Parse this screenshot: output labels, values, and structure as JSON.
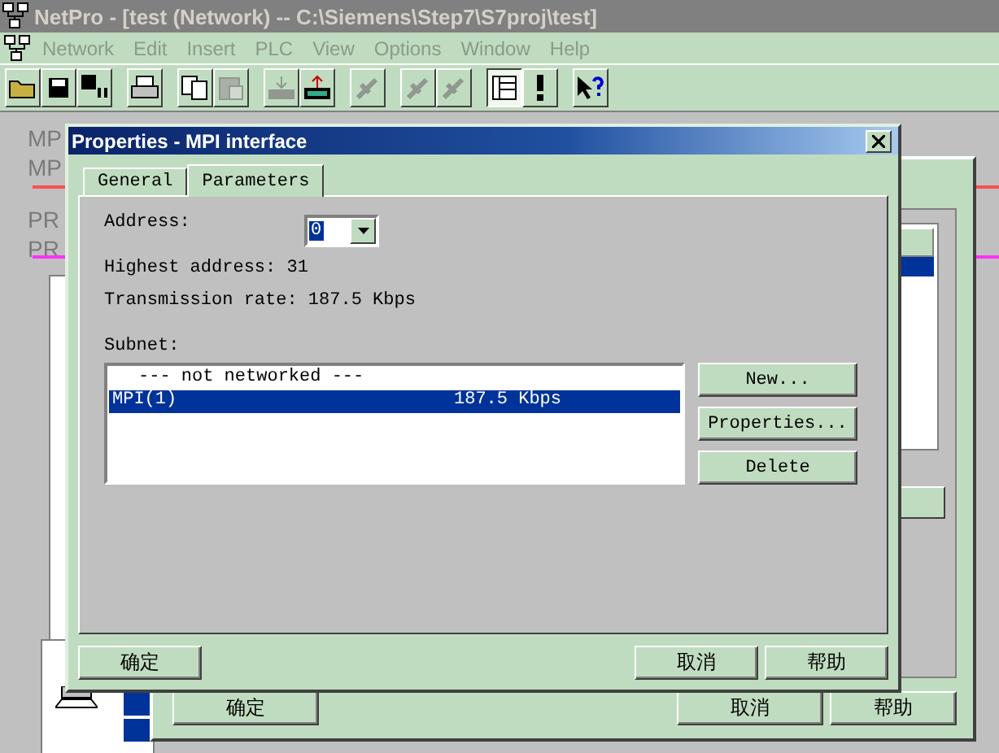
{
  "window": {
    "title": "NetPro - [test (Network) -- C:\\Siemens\\Step7\\S7proj\\test]"
  },
  "menu": [
    {
      "label": "Network",
      "disabled": true
    },
    {
      "label": "Edit",
      "disabled": true
    },
    {
      "label": "Insert",
      "disabled": true
    },
    {
      "label": "PLC",
      "disabled": true
    },
    {
      "label": "View",
      "disabled": true
    },
    {
      "label": "Options",
      "disabled": true
    },
    {
      "label": "Window",
      "disabled": true
    },
    {
      "label": "Help",
      "disabled": true
    }
  ],
  "toolbar": [
    [
      {
        "kind": "open",
        "disabled": false,
        "pressed": false
      },
      {
        "kind": "save",
        "disabled": false,
        "pressed": false
      },
      {
        "kind": "compile",
        "disabled": false,
        "pressed": false
      }
    ],
    [
      {
        "kind": "print",
        "disabled": false,
        "pressed": false
      }
    ],
    [
      {
        "kind": "copy",
        "disabled": false,
        "pressed": false
      },
      {
        "kind": "paste",
        "disabled": true,
        "pressed": false
      }
    ],
    [
      {
        "kind": "download",
        "disabled": true,
        "pressed": false
      },
      {
        "kind": "upload",
        "disabled": false,
        "pressed": false
      }
    ],
    [
      {
        "kind": "tool",
        "disabled": true,
        "pressed": false
      }
    ],
    [
      {
        "kind": "tool",
        "disabled": true,
        "pressed": false
      },
      {
        "kind": "tool",
        "disabled": true,
        "pressed": false
      }
    ],
    [
      {
        "kind": "catalog",
        "disabled": false,
        "pressed": true
      },
      {
        "kind": "exclaim",
        "disabled": false,
        "pressed": false
      }
    ],
    [
      {
        "kind": "help",
        "disabled": false,
        "pressed": false
      }
    ]
  ],
  "canvas_labels": [
    "MP",
    "MP",
    "PR",
    "PR"
  ],
  "back_dialog": {
    "buttons": [
      "确定",
      "取消",
      "帮助"
    ]
  },
  "dialog": {
    "title": "Properties - MPI interface",
    "tabs": [
      {
        "label": "General",
        "selected": false
      },
      {
        "label": "Parameters",
        "selected": true
      }
    ],
    "address": {
      "label": "Address:",
      "value": "0"
    },
    "highest_address": "Highest address: 31",
    "transmission_rate": "Transmission rate: 187.5 Kbps",
    "subnet": {
      "label": "Subnet:",
      "rows": [
        {
          "name": "--- not networked ---",
          "rate": "",
          "selected": false
        },
        {
          "name": "MPI(1)",
          "rate": "187.5 Kbps",
          "selected": true
        }
      ]
    },
    "side_buttons": [
      "New...",
      "Properties...",
      "Delete"
    ],
    "buttons": [
      "确定",
      "取消",
      "帮助"
    ]
  }
}
